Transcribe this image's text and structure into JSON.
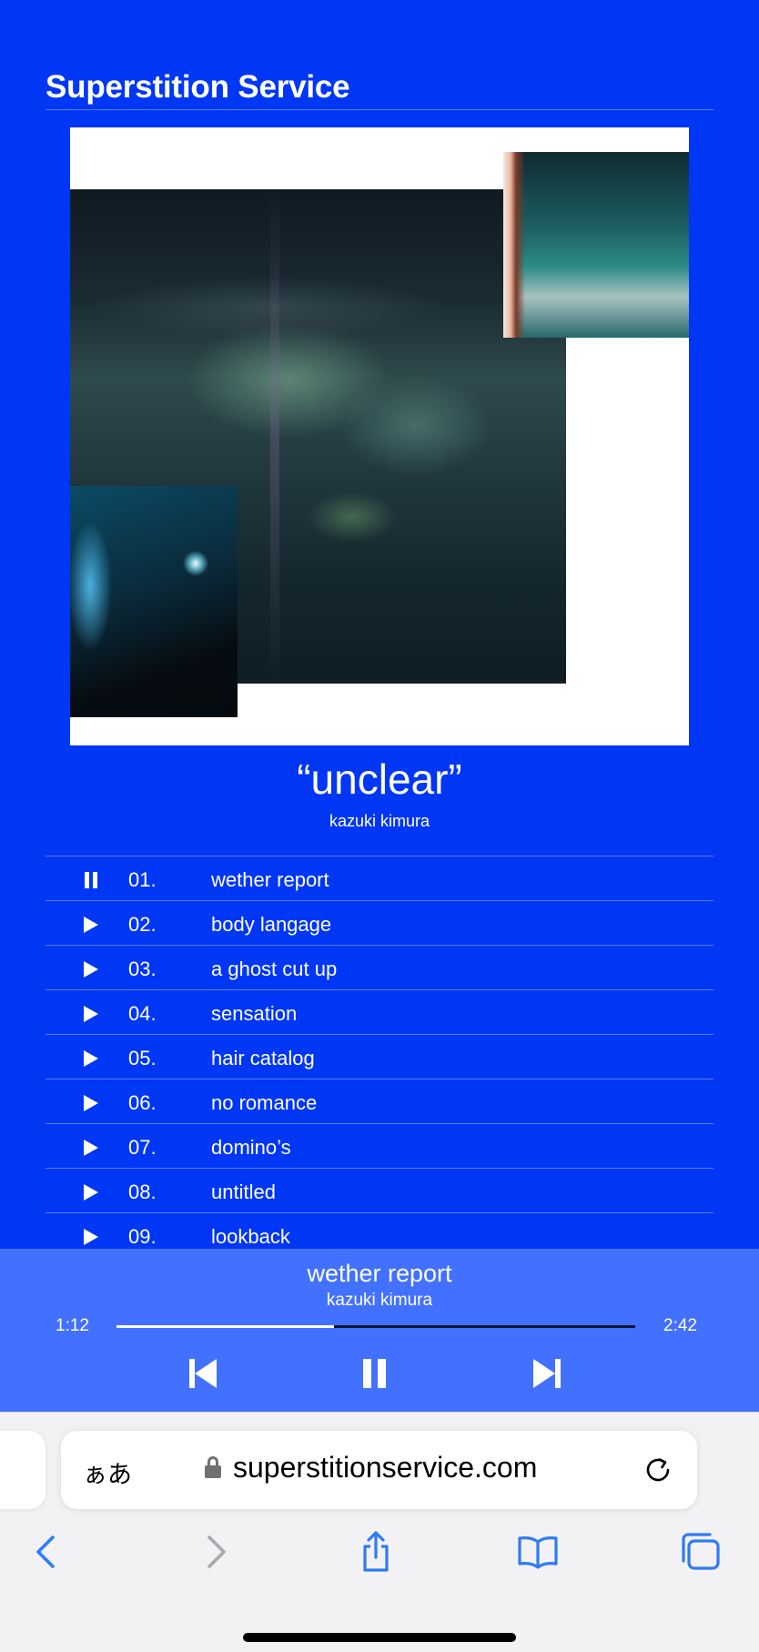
{
  "site": {
    "title": "Superstition Service"
  },
  "album": {
    "title": "“unclear”",
    "artist": "kazuki kimura"
  },
  "tracks": [
    {
      "state": "playing",
      "icon": "pause-icon",
      "number": "01.",
      "title": "wether report"
    },
    {
      "state": "idle",
      "icon": "play-icon",
      "number": "02.",
      "title": "body langage"
    },
    {
      "state": "idle",
      "icon": "play-icon",
      "number": "03.",
      "title": "a ghost cut up"
    },
    {
      "state": "idle",
      "icon": "play-icon",
      "number": "04.",
      "title": "sensation"
    },
    {
      "state": "idle",
      "icon": "play-icon",
      "number": "05.",
      "title": "hair catalog"
    },
    {
      "state": "idle",
      "icon": "play-icon",
      "number": "06.",
      "title": "no romance"
    },
    {
      "state": "idle",
      "icon": "play-icon",
      "number": "07.",
      "title": "domino’s"
    },
    {
      "state": "idle",
      "icon": "play-icon",
      "number": "08.",
      "title": "untitled"
    },
    {
      "state": "idle",
      "icon": "play-icon",
      "number": "09.",
      "title": "lookback"
    }
  ],
  "player": {
    "title": "wether report",
    "artist": "kazuki kimura",
    "current_time": "1:12",
    "total_time": "2:42",
    "progress_fraction": 0.42,
    "controls": [
      "previous-icon",
      "pause-icon",
      "next-icon"
    ]
  },
  "browser": {
    "aa_label": "ぁあ",
    "url": "superstitionservice.com",
    "toolbar": [
      "back-icon",
      "forward-icon",
      "share-icon",
      "bookmarks-icon",
      "tabs-icon"
    ]
  },
  "colors": {
    "background": "#0037f5",
    "player_background": "#4371ff",
    "text": "#ffffff",
    "browser_chrome": "#f2f2f4",
    "browser_accent": "#2f7bf5"
  }
}
